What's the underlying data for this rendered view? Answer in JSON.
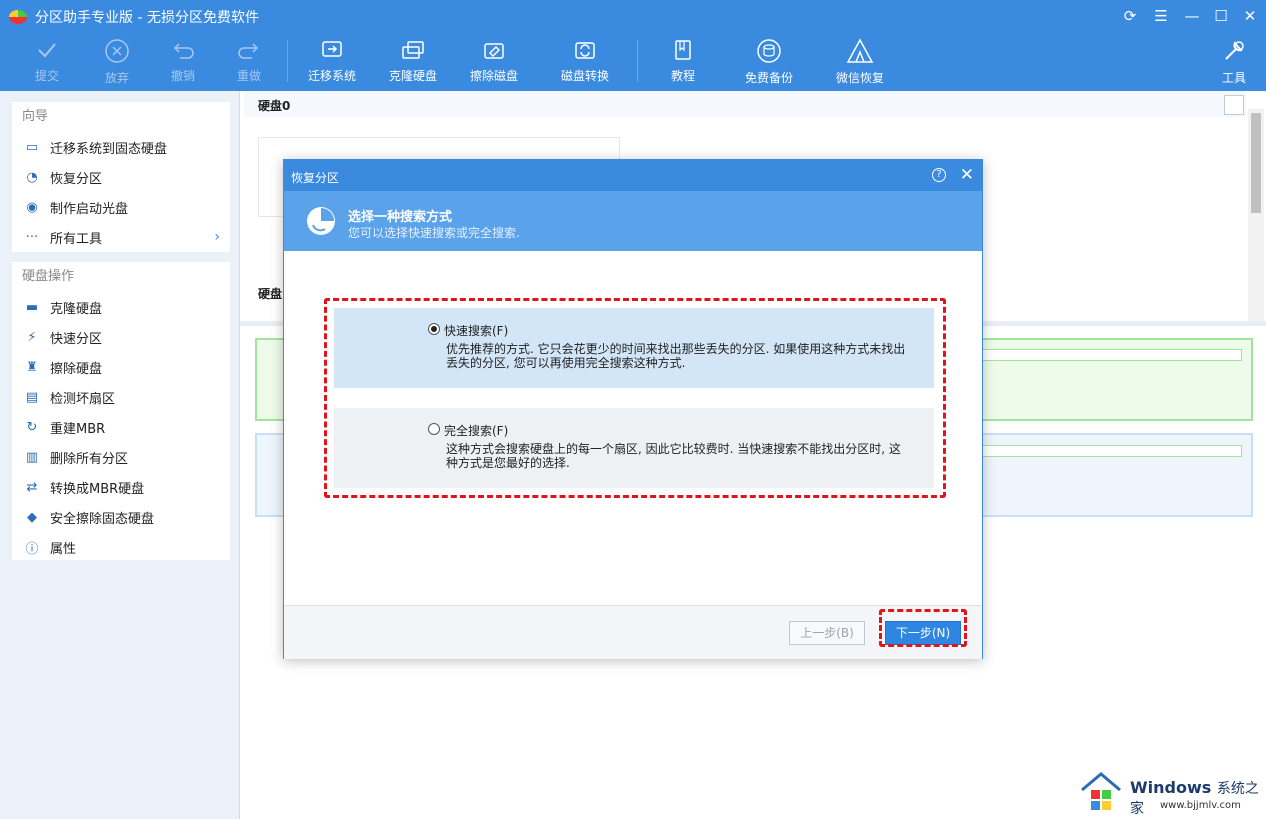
{
  "app": {
    "title": "分区助手专业版 - 无损分区免费软件"
  },
  "toolbar": {
    "buttons": [
      {
        "label": "提交",
        "icon": "check-icon",
        "enabled": false
      },
      {
        "label": "放弃",
        "icon": "cancel-circle-icon",
        "enabled": false
      },
      {
        "label": "撤销",
        "icon": "undo-icon",
        "enabled": false
      },
      {
        "label": "重做",
        "icon": "redo-icon",
        "enabled": false
      },
      {
        "label": "迁移系统",
        "icon": "migrate-os-icon",
        "enabled": true
      },
      {
        "label": "克隆硬盘",
        "icon": "clone-disk-icon",
        "enabled": true
      },
      {
        "label": "擦除磁盘",
        "icon": "wipe-disk-icon",
        "enabled": true
      },
      {
        "label": "磁盘转换",
        "icon": "convert-disk-icon",
        "enabled": true
      },
      {
        "label": "教程",
        "icon": "book-icon",
        "enabled": true
      },
      {
        "label": "免费备份",
        "icon": "backup-icon",
        "enabled": true
      },
      {
        "label": "微信恢复",
        "icon": "wechat-recover-icon",
        "enabled": true
      },
      {
        "label": "工具",
        "icon": "tools-icon",
        "enabled": true
      }
    ]
  },
  "sidebar": {
    "wizard": {
      "title": "向导",
      "items": [
        {
          "label": "迁移系统到固态硬盘",
          "icon": "migrate-ssd-icon"
        },
        {
          "label": "恢复分区",
          "icon": "pie-recover-icon"
        },
        {
          "label": "制作启动光盘",
          "icon": "boot-disc-icon"
        },
        {
          "label": "所有工具",
          "icon": "more-dots-icon"
        }
      ]
    },
    "disk_ops": {
      "title": "硬盘操作",
      "items": [
        {
          "label": "克隆硬盘",
          "icon": "clone-icon"
        },
        {
          "label": "快速分区",
          "icon": "lightning-icon"
        },
        {
          "label": "擦除硬盘",
          "icon": "broom-icon"
        },
        {
          "label": "检测坏扇区",
          "icon": "scan-icon"
        },
        {
          "label": "重建MBR",
          "icon": "rebuild-icon"
        },
        {
          "label": "删除所有分区",
          "icon": "trash-icon"
        },
        {
          "label": "转换成MBR硬盘",
          "icon": "convert-icon"
        },
        {
          "label": "安全擦除固态硬盘",
          "icon": "eraser-icon"
        },
        {
          "label": "属性",
          "icon": "info-icon"
        }
      ]
    }
  },
  "main": {
    "disk0_label": "硬盘0",
    "disk1_label": "硬盘"
  },
  "dialog": {
    "title": "恢复分区",
    "help_glyph": "?",
    "header_title": "选择一种搜索方式",
    "header_subtitle": "您可以选择快速搜索或完全搜索.",
    "options": [
      {
        "label": "快速搜索(F)",
        "selected": true,
        "description": "优先推荐的方式. 它只会花更少的时间来找出那些丢失的分区. 如果使用这种方式未找出丢失的分区, 您可以再使用完全搜索这种方式."
      },
      {
        "label": "完全搜索(F)",
        "selected": false,
        "description": "这种方式会搜索硬盘上的每一个扇区, 因此它比较费时. 当快速搜索不能找出分区时, 这种方式是您最好的选择."
      }
    ],
    "prev_button": "上一步(B)",
    "next_button": "下一步(N)"
  },
  "watermark": {
    "brand": "Windows",
    "brand_suffix": "系统之家",
    "site": "www.bjjmlv.com"
  },
  "colors": {
    "accent": "#3a8ae0",
    "header": "#5aa2ea",
    "highlight": "#e0141d",
    "selected_option": "#d3e6f8"
  }
}
